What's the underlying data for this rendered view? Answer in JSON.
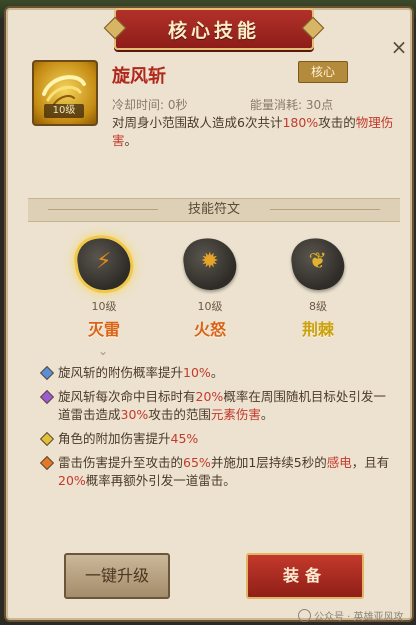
{
  "window": {
    "title": "核心技能",
    "close_symbol": "×"
  },
  "skill": {
    "name": "旋风斩",
    "level_tag": "10级",
    "badge": "核心",
    "cooldown": "冷却时间: 0秒",
    "energy_cost": "能量消耗: 30点",
    "description": {
      "part1": "对周身小范围敌人造成6次共计",
      "highlight": "180%",
      "part2": "攻击的",
      "type": "物理伤害",
      "end": "。"
    }
  },
  "runes": {
    "section_title": "技能符文",
    "items": [
      {
        "level": "10级",
        "name": "灭雷",
        "icon": "lightning-rune-icon",
        "selected": true
      },
      {
        "level": "10级",
        "name": "火怒",
        "icon": "fire-rune-icon",
        "selected": false
      },
      {
        "level": "8级",
        "name": "荆棘",
        "icon": "thorn-rune-icon",
        "selected": false
      }
    ]
  },
  "effects": [
    {
      "color": "#5b8fd6",
      "pre": "旋风斩的附伤概率提升",
      "hl": "10%",
      "post": "。"
    },
    {
      "color": "#9c5bd1",
      "pre": "旋风斩每次命中目标时有",
      "hl": "20%",
      "mid": "概率在周围随机目标处引发一道雷击造成",
      "hl2": "30%",
      "mid2": "攻击的范围",
      "hl3": "元素伤害",
      "post": "。"
    },
    {
      "color": "#e0c03a",
      "pre": "角色的附加伤害提升",
      "hl": "45%",
      "post": ""
    },
    {
      "color": "#e07a2a",
      "pre": "雷击伤害提升至攻击的",
      "hl": "65%",
      "mid": "并施加1层持续5秒的",
      "hl2": "感电",
      "mid2": "，且有",
      "hl3": "20%",
      "post": "概率再额外引发一道雷击。"
    }
  ],
  "buttons": {
    "upgrade": "一键升级",
    "equip": "装备"
  },
  "watermark": "公众号 · 英雄亚风攻略站"
}
